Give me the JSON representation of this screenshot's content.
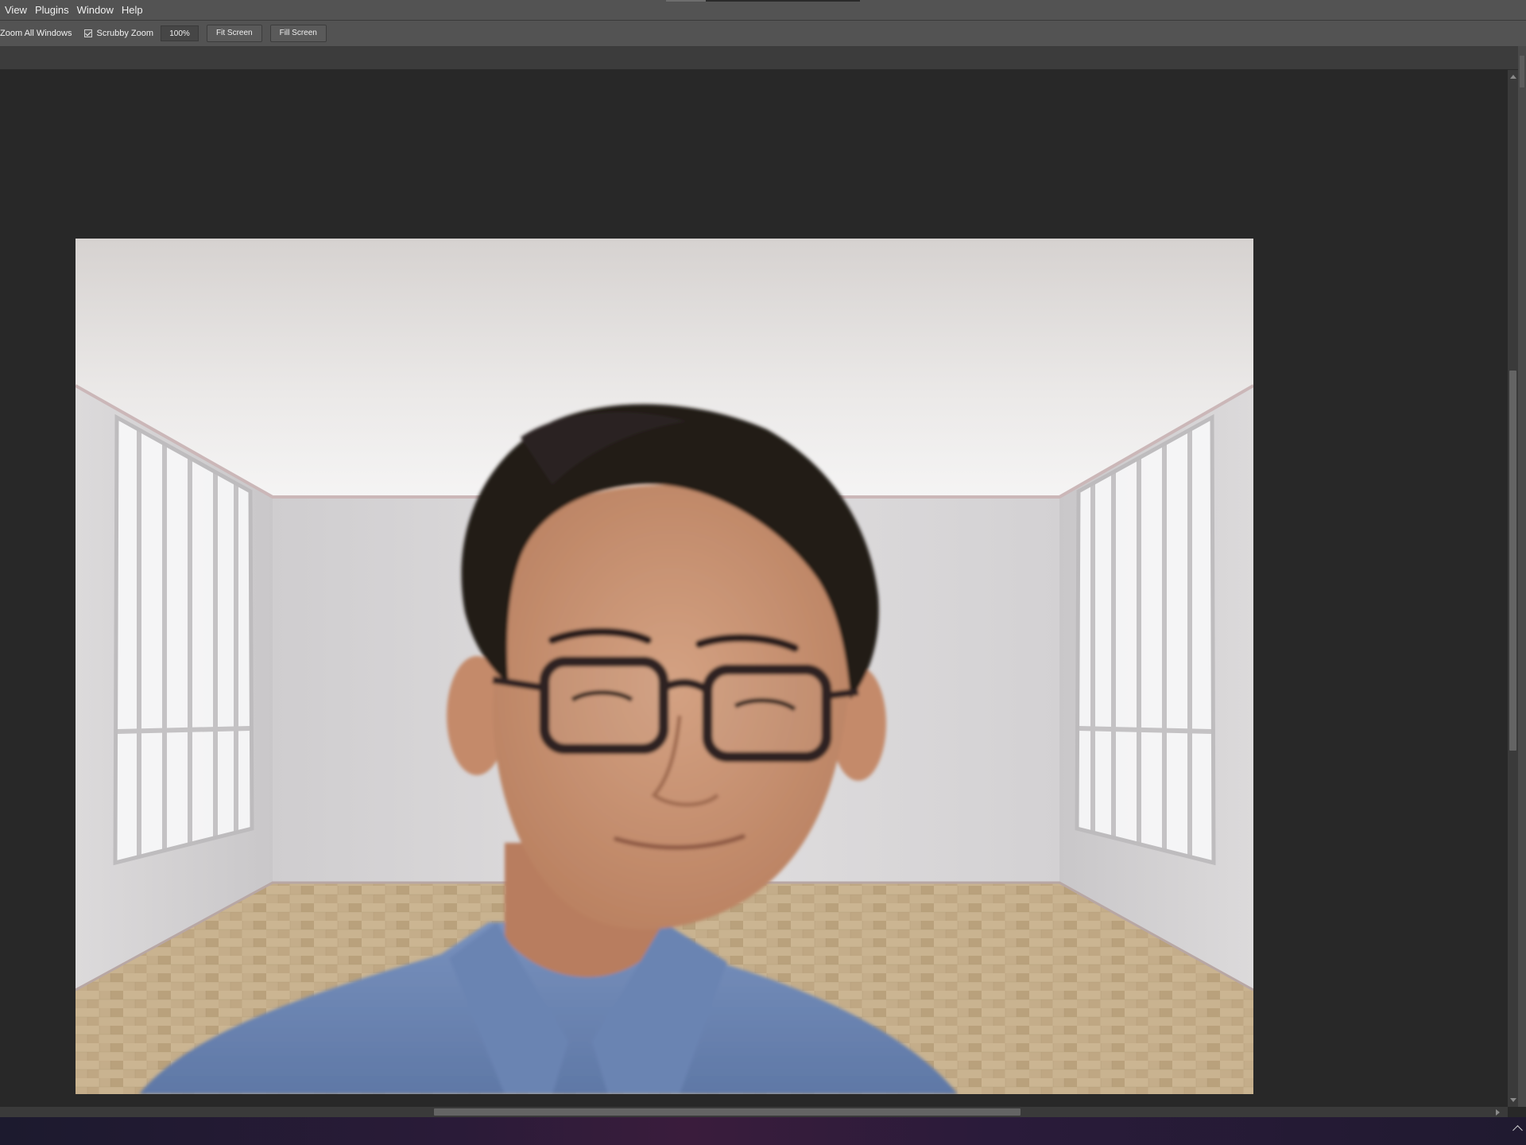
{
  "menu": {
    "items": [
      {
        "label": "View"
      },
      {
        "label": "Plugins"
      },
      {
        "label": "Window"
      },
      {
        "label": "Help"
      }
    ]
  },
  "options": {
    "zoom_all_windows": "Zoom All Windows",
    "scrubby_zoom": "Scrubby Zoom",
    "scrubby_checked": true,
    "zoom_value": "100%",
    "fit_screen": "Fit Screen",
    "fill_screen": "Fill Screen"
  },
  "canvas": {
    "image_subject": "portrait-photo-in-empty-room"
  },
  "scroll": {
    "vertical_position": 0.29,
    "horizontal_position": 0.29
  },
  "colors": {
    "menubar_bg": "#535353",
    "canvas_bg": "#282828",
    "shirt": "#6f88b5",
    "hair": "#201a18",
    "skin": "#c99474"
  }
}
